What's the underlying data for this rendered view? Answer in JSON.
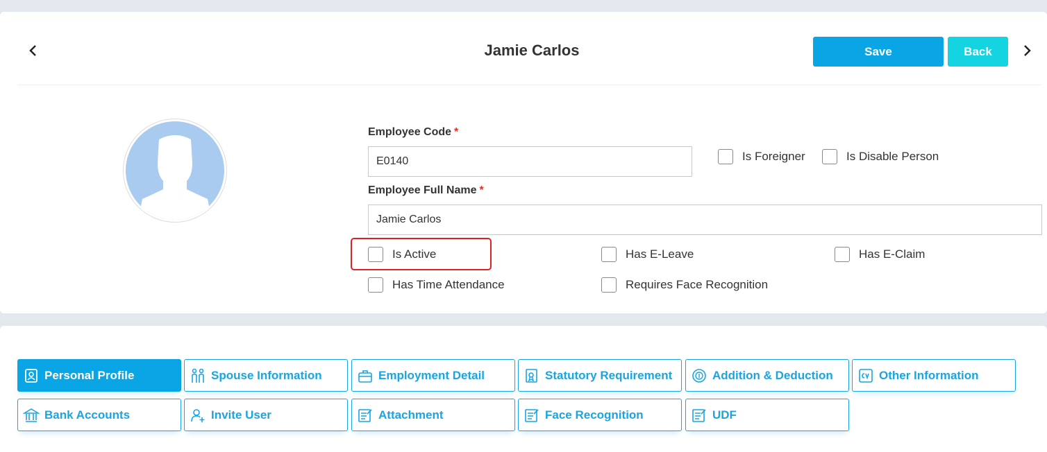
{
  "header": {
    "title": "Jamie Carlos",
    "save_label": "Save",
    "back_label": "Back"
  },
  "form": {
    "employee_code_label": "Employee Code",
    "employee_code_value": "E0140",
    "employee_full_name_label": "Employee Full Name",
    "employee_full_name_value": "Jamie Carlos",
    "required_marker": "*"
  },
  "checkboxes": {
    "is_foreigner": "Is Foreigner",
    "is_disable_person": "Is Disable Person",
    "is_active": "Is Active",
    "has_e_leave": "Has E-Leave",
    "has_e_claim": "Has E-Claim",
    "has_time_attendance": "Has Time Attendance",
    "requires_face_recognition": "Requires Face Recognition"
  },
  "tabs": [
    {
      "label": "Personal Profile",
      "icon": "profile-icon",
      "active": true
    },
    {
      "label": "Spouse Information",
      "icon": "couple-icon"
    },
    {
      "label": "Employment Detail",
      "icon": "briefcase-icon"
    },
    {
      "label": "Statutory Requirement",
      "icon": "certificate-icon"
    },
    {
      "label": "Addition & Deduction",
      "icon": "money-icon"
    },
    {
      "label": "Other Information",
      "icon": "cv-icon"
    },
    {
      "label": "Bank Accounts",
      "icon": "bank-icon"
    },
    {
      "label": "Invite User",
      "icon": "add-user-icon"
    },
    {
      "label": "Attachment",
      "icon": "document-icon"
    },
    {
      "label": "Face Recognition",
      "icon": "document-icon"
    },
    {
      "label": "UDF",
      "icon": "document-icon"
    }
  ],
  "colors": {
    "primary": "#0aa5e5",
    "back": "#14d4e1",
    "required": "#dd3322",
    "highlight": "#e02020",
    "avatar": "#a9cbef"
  }
}
